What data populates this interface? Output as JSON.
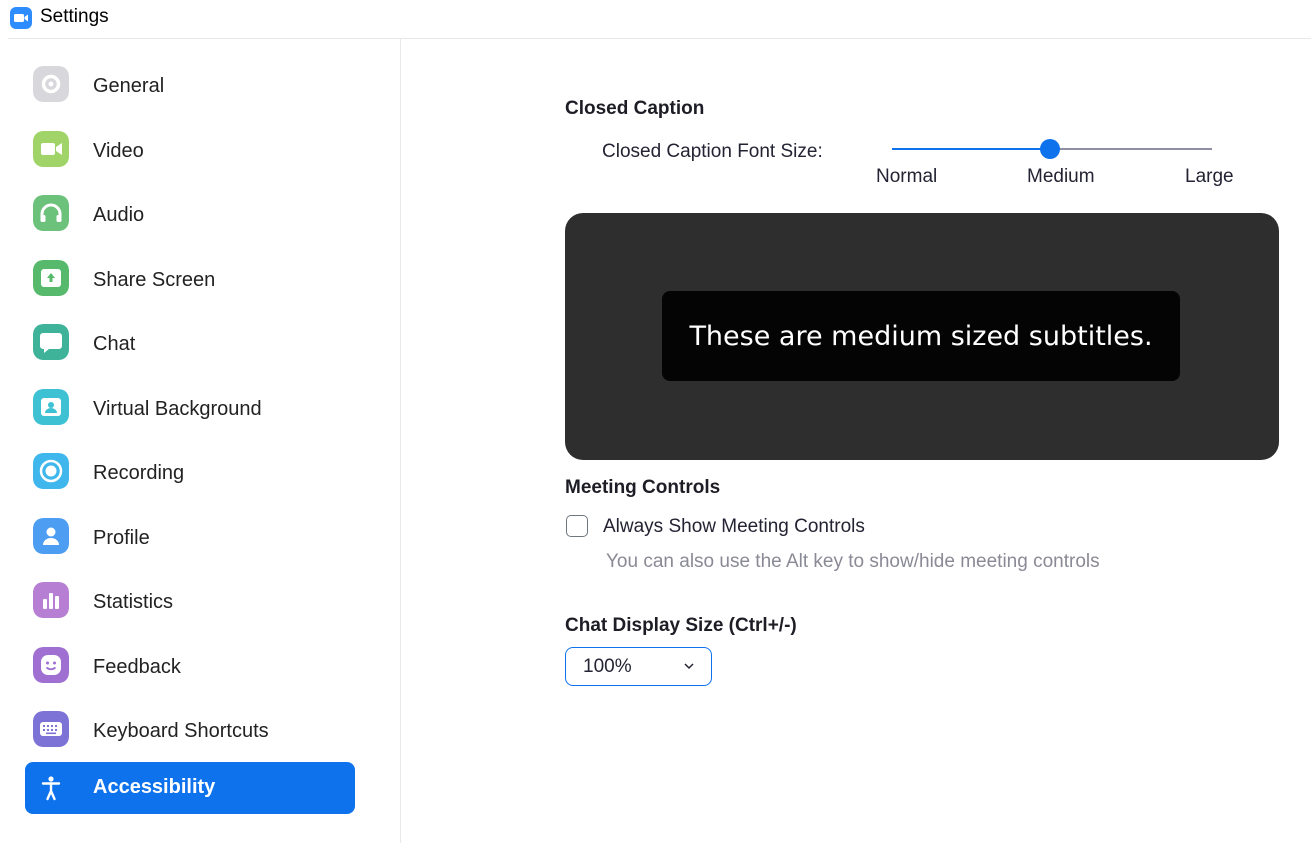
{
  "window": {
    "title": "Settings"
  },
  "sidebar": {
    "items": [
      {
        "label": "General",
        "icon": "gear-icon",
        "color": "#d7d7dc"
      },
      {
        "label": "Video",
        "icon": "video-camera-icon",
        "color": "#a0d468"
      },
      {
        "label": "Audio",
        "icon": "headphones-icon",
        "color": "#6cc17b"
      },
      {
        "label": "Share Screen",
        "icon": "share-screen-icon",
        "color": "#57b96b"
      },
      {
        "label": "Chat",
        "icon": "chat-bubble-icon",
        "color": "#3fb39a"
      },
      {
        "label": "Virtual Background",
        "icon": "virtual-background-icon",
        "color": "#3dc1d3"
      },
      {
        "label": "Recording",
        "icon": "record-icon",
        "color": "#3fb6ec"
      },
      {
        "label": "Profile",
        "icon": "profile-icon",
        "color": "#4d9ef2"
      },
      {
        "label": "Statistics",
        "icon": "bar-chart-icon",
        "color": "#b77fd3"
      },
      {
        "label": "Feedback",
        "icon": "smiley-icon",
        "color": "#9f6fd1"
      },
      {
        "label": "Keyboard Shortcuts",
        "icon": "keyboard-icon",
        "color": "#7d72d6"
      },
      {
        "label": "Accessibility",
        "icon": "accessibility-icon",
        "color": "#0e72ed",
        "active": true
      }
    ]
  },
  "closed_caption": {
    "title": "Closed Caption",
    "font_size_label": "Closed Caption Font Size:",
    "slider": {
      "options": [
        "Normal",
        "Medium",
        "Large"
      ],
      "selected": "Medium",
      "selected_fraction": 0.5
    },
    "preview_text": "These are medium sized subtitles."
  },
  "meeting_controls": {
    "title": "Meeting Controls",
    "checkbox_label": "Always Show Meeting Controls",
    "checked": false,
    "hint": "You can also use the Alt key to show/hide meeting controls"
  },
  "chat_display": {
    "title": "Chat Display Size (Ctrl+/-)",
    "value": "100%"
  },
  "colors": {
    "accent": "#0e72ed",
    "track_inactive": "#8e8fa5",
    "preview_bg": "#2e2e2e"
  }
}
